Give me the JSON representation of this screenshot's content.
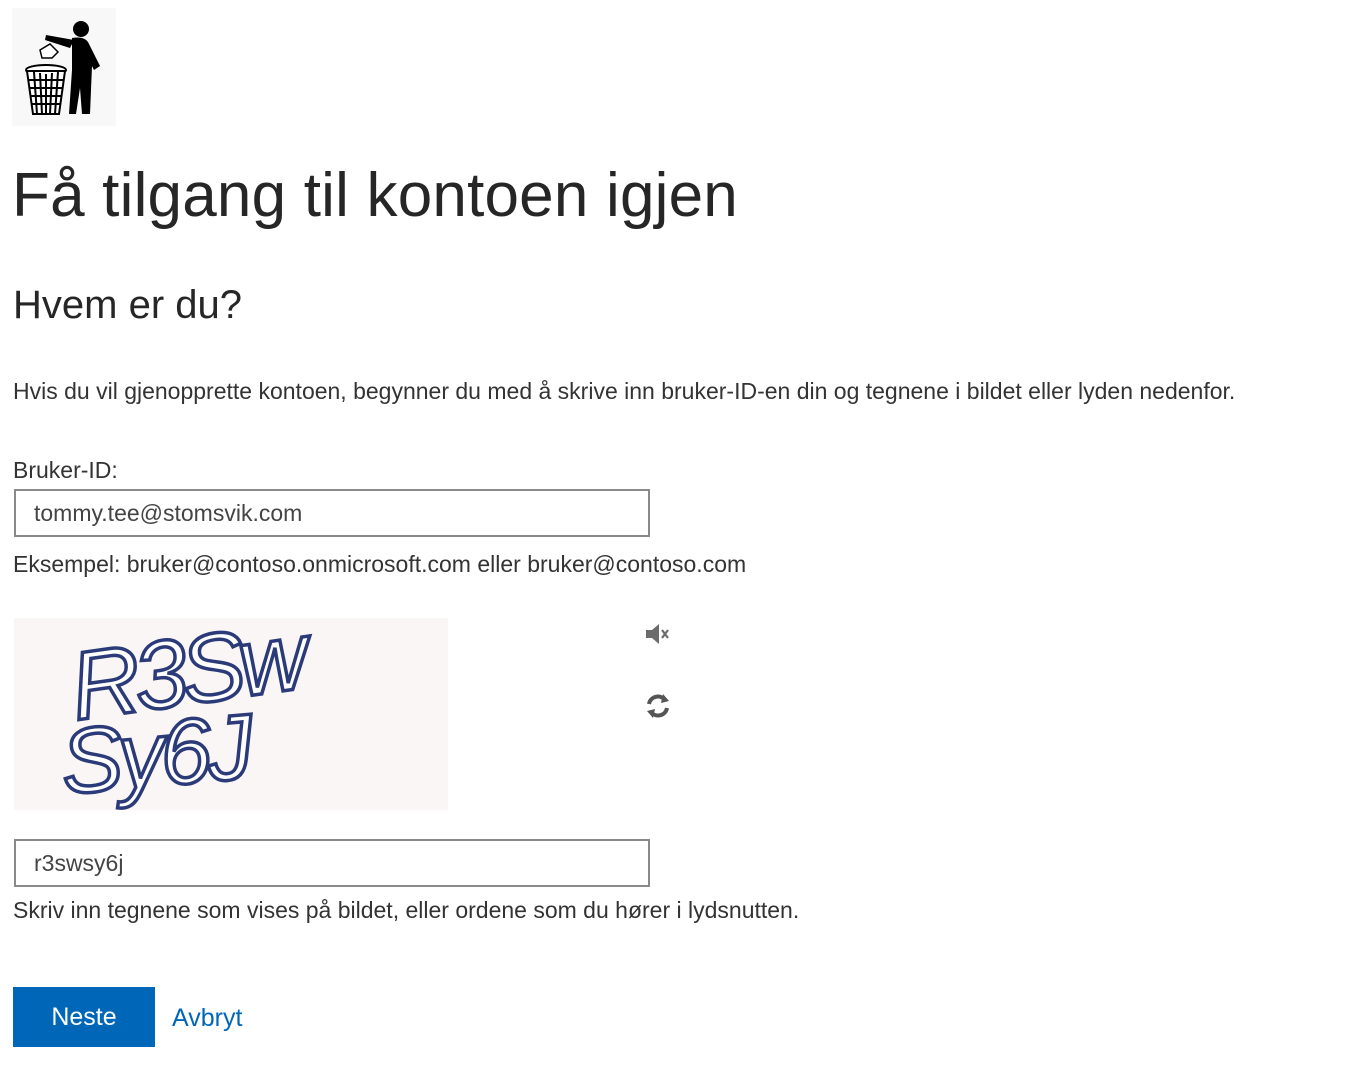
{
  "logo": {
    "icon": "trash-bin-person-icon"
  },
  "page": {
    "title": "Få tilgang til kontoen igjen",
    "subtitle": "Hvem er du?",
    "intro": "Hvis du vil gjenopprette kontoen, begynner du med å skrive inn bruker-ID-en din og tegnene i bildet eller lyden nedenfor."
  },
  "user_id": {
    "label": "Bruker-ID:",
    "value": "tommy.tee@stomsvik.com",
    "hint": "Eksempel: bruker@contoso.onmicrosoft.com eller bruker@contoso.com"
  },
  "captcha": {
    "image_text_line1": "R3Sw",
    "image_text_line2": "Sy6J",
    "audio_icon": "speaker-icon",
    "refresh_icon": "refresh-icon",
    "value": "r3swsy6j",
    "hint": "Skriv inn tegnene som vises på bildet, eller ordene som du hører i lydsnutten."
  },
  "actions": {
    "next_label": "Neste",
    "cancel_label": "Avbryt"
  },
  "colors": {
    "accent": "#0067b8",
    "text": "#333333",
    "input_border": "#8a8a8a",
    "captcha_stroke": "#2b3a78"
  }
}
